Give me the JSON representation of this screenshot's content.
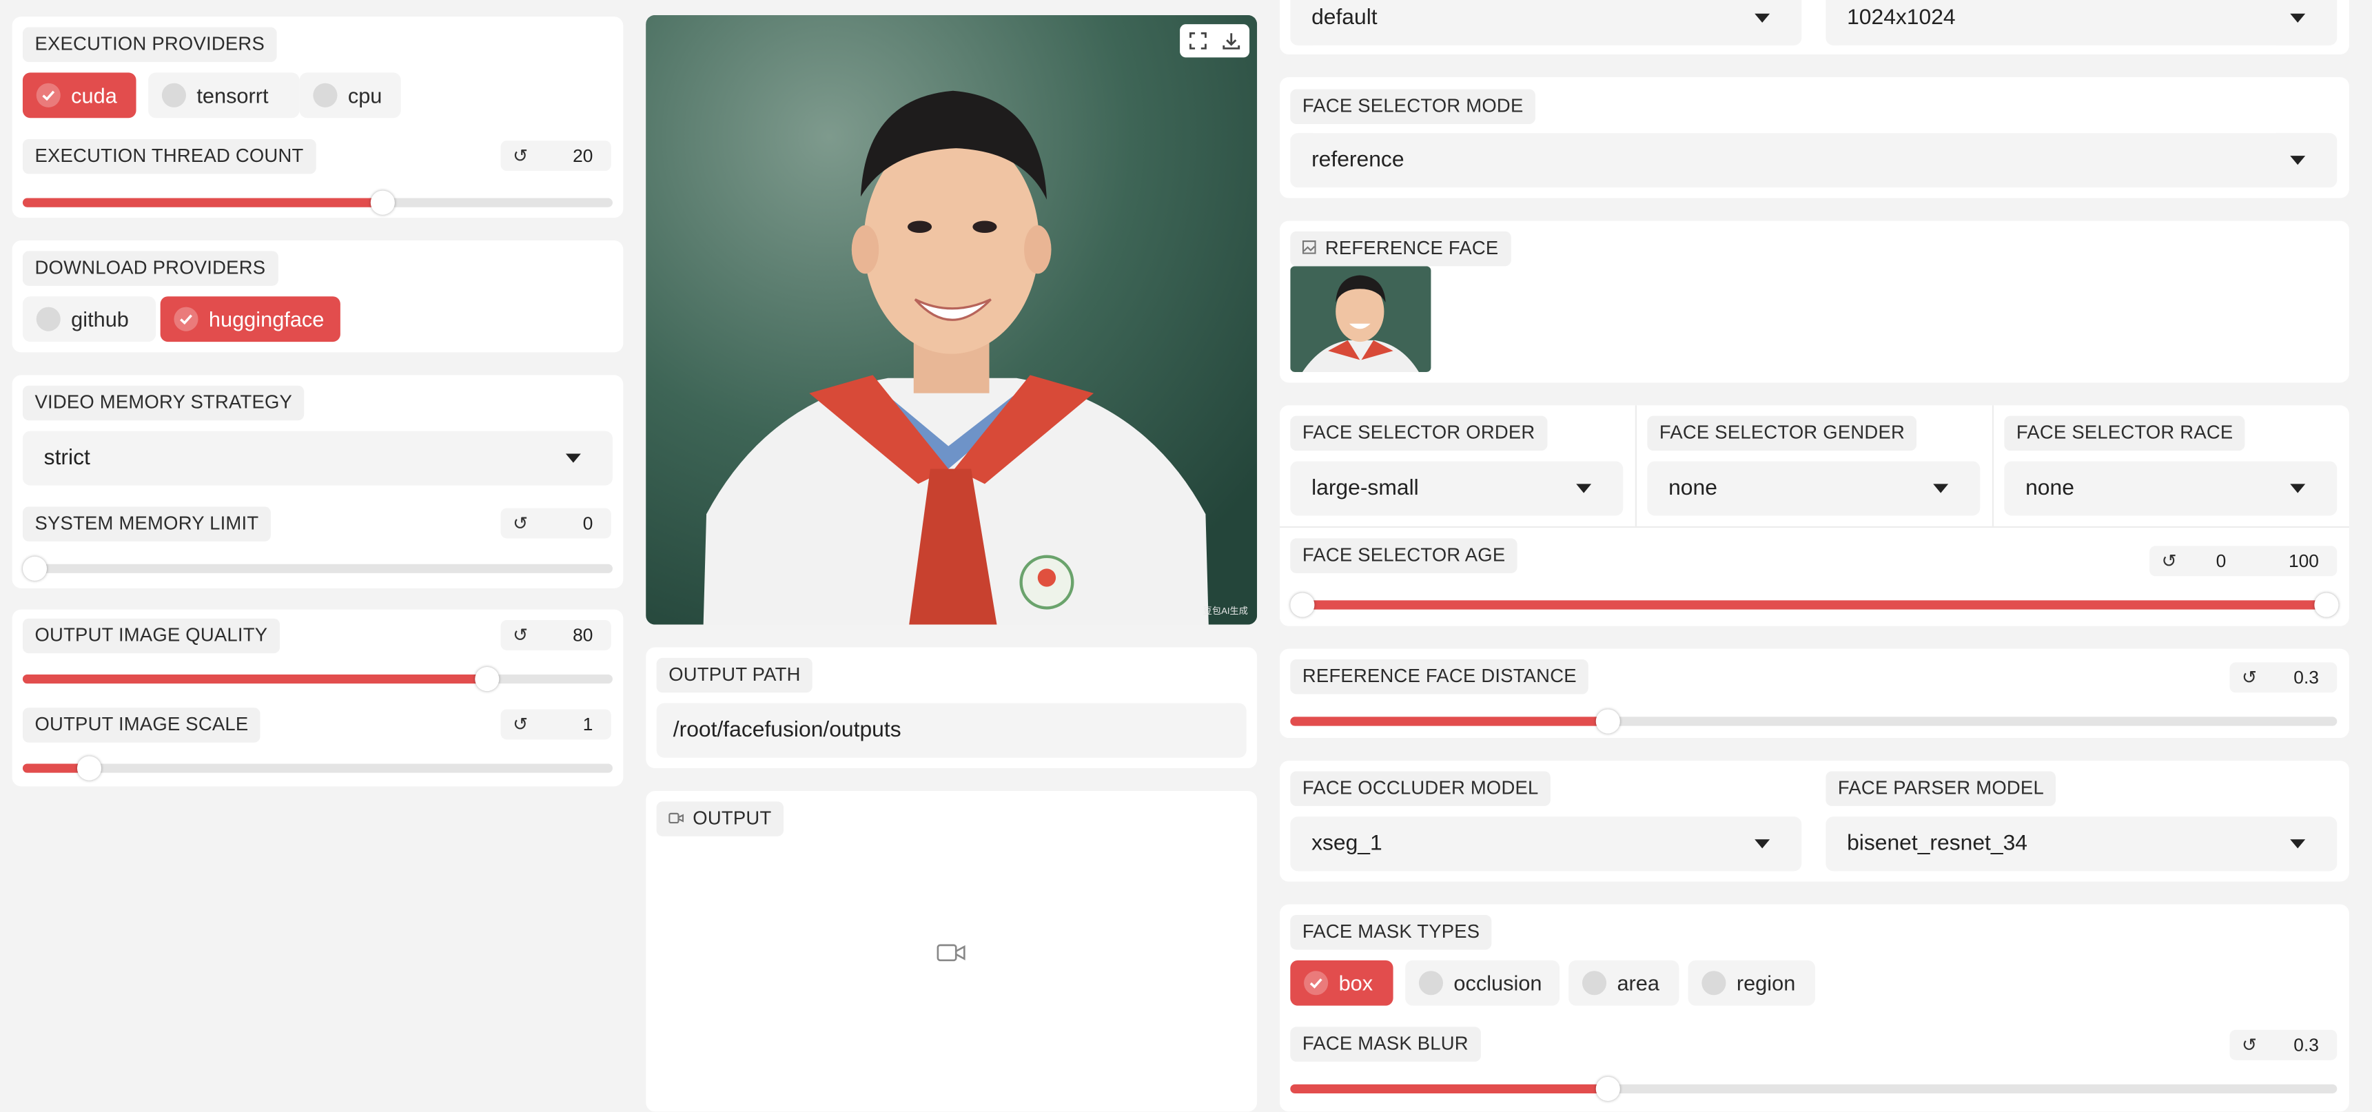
{
  "left": {
    "execution_providers": {
      "title": "EXECUTION PROVIDERS",
      "options": [
        {
          "label": "cuda",
          "checked": true
        },
        {
          "label": "tensorrt",
          "checked": false
        },
        {
          "label": "cpu",
          "checked": false
        }
      ]
    },
    "execution_thread_count": {
      "title": "EXECUTION THREAD COUNT",
      "value": "20",
      "reset": "↺",
      "fraction": 0.61
    },
    "download_providers": {
      "title": "DOWNLOAD PROVIDERS",
      "options": [
        {
          "label": "github",
          "checked": false
        },
        {
          "label": "huggingface",
          "checked": true
        }
      ]
    },
    "video_memory_strategy": {
      "title": "VIDEO MEMORY STRATEGY",
      "value": "strict"
    },
    "system_memory_limit": {
      "title": "SYSTEM MEMORY LIMIT",
      "value": "0",
      "reset": "↺",
      "fraction": 0.0
    },
    "output_image_quality": {
      "title": "OUTPUT IMAGE QUALITY",
      "value": "80",
      "reset": "↺",
      "fraction": 0.79
    },
    "output_image_scale": {
      "title": "OUTPUT IMAGE SCALE",
      "value": "1",
      "reset": "↺",
      "fraction": 0.11
    }
  },
  "middle": {
    "preview": {
      "watermark": "豆包AI生成",
      "fullscreen_icon": "fullscreen-icon",
      "download_icon": "download-icon"
    },
    "output_path": {
      "title": "OUTPUT PATH",
      "value": "/root/facefusion/outputs"
    },
    "output": {
      "title": "OUTPUT",
      "icon": "video-camera-icon"
    }
  },
  "right": {
    "top_selects": {
      "left": "default",
      "right": "1024x1024"
    },
    "face_selector_mode": {
      "title": "FACE SELECTOR MODE",
      "value": "reference"
    },
    "reference_face": {
      "title": "REFERENCE FACE",
      "icon": "image-icon"
    },
    "face_selector_order": {
      "title": "FACE SELECTOR ORDER",
      "value": "large-small"
    },
    "face_selector_gender": {
      "title": "FACE SELECTOR GENDER",
      "value": "none"
    },
    "face_selector_race": {
      "title": "FACE SELECTOR RACE",
      "value": "none"
    },
    "face_selector_age": {
      "title": "FACE SELECTOR AGE",
      "min": "0",
      "max": "100",
      "reset": "↺",
      "range": [
        0.01,
        0.99
      ]
    },
    "reference_face_distance": {
      "title": "REFERENCE FACE DISTANCE",
      "value": "0.3",
      "reset": "↺",
      "fraction": 0.3
    },
    "face_occluder_model": {
      "title": "FACE OCCLUDER MODEL",
      "value": "xseg_1"
    },
    "face_parser_model": {
      "title": "FACE PARSER MODEL",
      "value": "bisenet_resnet_34"
    },
    "face_mask_types": {
      "title": "FACE MASK TYPES",
      "options": [
        {
          "label": "box",
          "checked": true
        },
        {
          "label": "occlusion",
          "checked": false
        },
        {
          "label": "area",
          "checked": false
        },
        {
          "label": "region",
          "checked": false
        }
      ]
    },
    "face_mask_blur": {
      "title": "FACE MASK BLUR",
      "value": "0.3",
      "reset": "↺",
      "fraction": 0.3
    }
  },
  "colors": {
    "accent": "#e24d4d",
    "panel": "#ffffff",
    "background": "#f3f3f3",
    "field": "#f4f4f4"
  }
}
